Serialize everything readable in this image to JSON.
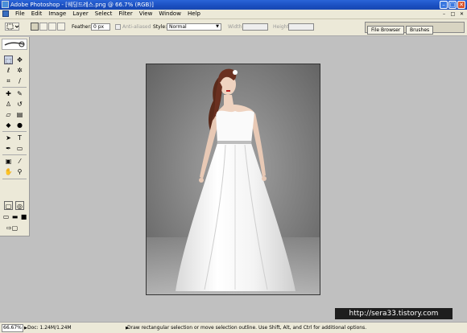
{
  "window": {
    "title": "Adobe Photoshop - [웨딩드레스.png @ 66.7% (RGB)]",
    "minimize_glyph": "–",
    "maximize_glyph": "□",
    "close_glyph": "✕"
  },
  "menu": {
    "items": [
      "File",
      "Edit",
      "Image",
      "Layer",
      "Select",
      "Filter",
      "View",
      "Window",
      "Help"
    ],
    "doc_controls": [
      "–",
      "□",
      "✕"
    ]
  },
  "options": {
    "feather_label": "Feather:",
    "feather_value": "0 px",
    "anti_aliased_label": "Anti-aliased",
    "style_label": "Style:",
    "style_value": "Normal",
    "style_arrow": "▼",
    "width_label": "Width:",
    "height_label": "Height:",
    "palette_tabs": [
      "File Browser",
      "Brushes"
    ]
  },
  "toolbox": {
    "foreground_color": "#b81e7e",
    "background_color": "#ffffff"
  },
  "document": {
    "watermark": "http://sera33.tistory.com"
  },
  "status": {
    "zoom": "66.67%",
    "doc_info": "Doc: 1.24M/1.24M",
    "hint": "Draw rectangular selection or move selection outline. Use Shift, Alt, and Ctrl for additional options.",
    "arrow": "▶"
  },
  "colors": {
    "titlebar": "#1a4fc0",
    "chrome": "#ece9d8",
    "workspace": "#c0c0c0"
  }
}
